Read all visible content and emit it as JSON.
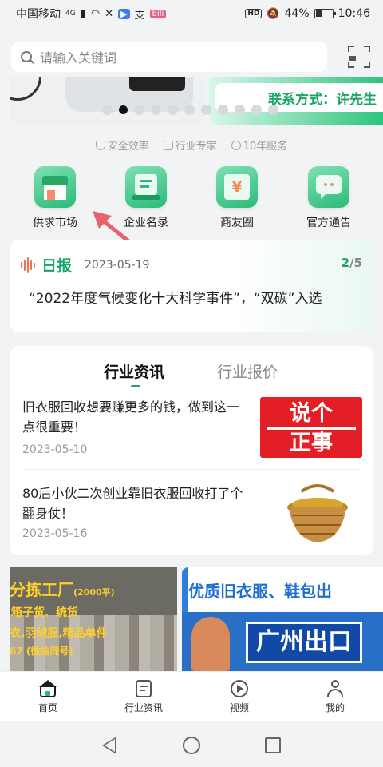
{
  "status_bar": {
    "carrier": "中国移动",
    "network": "4G",
    "battery": "44%",
    "battery_level": 0.44,
    "time": "10:46",
    "hd": "HD",
    "app_badge_1": "▶",
    "app_badge_2": "支",
    "app_badge_3": "bili"
  },
  "search": {
    "placeholder": "请输入关键词"
  },
  "banner": {
    "contact_text": "联系方式：许先生",
    "dot_count": 11,
    "active_index": 1
  },
  "features": [
    {
      "icon": "shield-icon",
      "label": "安全效率"
    },
    {
      "icon": "briefcase-icon",
      "label": "行业专家"
    },
    {
      "icon": "heart-icon",
      "label": "10年服务"
    }
  ],
  "quick_links": [
    {
      "label": "供求市场",
      "icon": "shop-icon"
    },
    {
      "label": "企业名录",
      "icon": "directory-icon"
    },
    {
      "label": "商友圈",
      "icon": "circle-icon"
    },
    {
      "label": "官方通告",
      "icon": "notice-icon"
    }
  ],
  "daily": {
    "title": "日报",
    "date": "2023-05-19",
    "current": "2",
    "total": "/5",
    "headline": "“2022年度气候变化十大科学事件”，“双碳”入选"
  },
  "news": {
    "tabs": [
      {
        "label": "行业资讯",
        "active": true
      },
      {
        "label": "行业报价",
        "active": false
      }
    ],
    "articles": [
      {
        "title": "旧衣服回收想要赚更多的钱，做到这一点很重要！",
        "date": "2023-05-10",
        "thumb_line1": "说个",
        "thumb_line2": "正事"
      },
      {
        "title": "80后小伙二次创业靠旧衣服回收打了个翻身仗！",
        "date": "2023-05-16"
      }
    ]
  },
  "ads": [
    {
      "line1": "分拣工厂",
      "line1_note": "(2000平)",
      "line2": "箱子货、统货",
      "line3": "衣,羽绒服,精品单件",
      "line4": "67 (微信同号)"
    },
    {
      "line1": "优质旧衣服、鞋包出",
      "line2": "广州出口"
    }
  ],
  "bottom_nav": [
    {
      "label": "首页",
      "icon": "home-icon",
      "active": true
    },
    {
      "label": "行业资讯",
      "icon": "news-icon",
      "active": false
    },
    {
      "label": "视频",
      "icon": "video-icon",
      "active": false
    },
    {
      "label": "我的",
      "icon": "profile-icon",
      "active": false
    }
  ],
  "colors": {
    "accent": "#1aa566",
    "annotation_arrow": "#e8636a"
  }
}
